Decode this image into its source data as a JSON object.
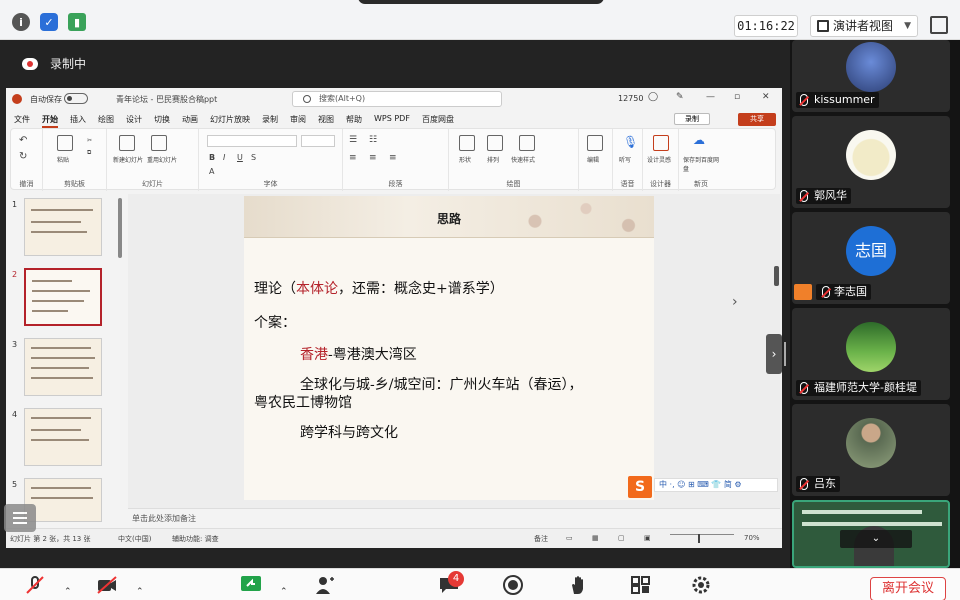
{
  "topbar": {
    "timer": "01:16:22",
    "view_mode": "演讲者视图"
  },
  "recording": {
    "label": "录制中"
  },
  "ppt": {
    "autosave": "自动保存",
    "filename": "青年论坛 - 巴民赛股合稿ppt",
    "search_placeholder": "搜索(Alt+Q)",
    "number": "12750",
    "menu": [
      "文件",
      "开始",
      "插入",
      "绘图",
      "设计",
      "切换",
      "动画",
      "幻灯片放映",
      "录制",
      "审阅",
      "视图",
      "帮助",
      "WPS PDF",
      "百度网盘"
    ],
    "record_button": "录制",
    "share_button": "共享",
    "ribbon_groups": [
      "撤消",
      "剪贴板",
      "幻灯片",
      "字体",
      "段落",
      "绘图",
      "",
      "语音",
      "设计器",
      "新页"
    ],
    "ribbon_items": {
      "paste": "粘贴",
      "new_slide": "新建幻灯片",
      "reuse_slide": "重用幻灯片",
      "shape": "形状",
      "arrange": "排列",
      "quick_style": "快速样式",
      "edit": "编辑",
      "dictate": "听写",
      "designer": "设计灵感",
      "save_to": "保存到百度网盘"
    },
    "slide_numbers": [
      "1",
      "2",
      "3",
      "4",
      "5"
    ],
    "slide": {
      "title": "思路",
      "line1_prefix": "理论（",
      "line1_red": "本体论",
      "line1_suffix": "，还需：概念史+谱系学）",
      "line2": "个案：",
      "line3_red": "香港",
      "line3_suffix": "-粤港澳大湾区",
      "line4": "全球化与城-乡/城空间：广州火车站（春运），",
      "line5": "粤农民工博物馆",
      "line6": "跨学科与跨文化"
    },
    "ime_bar": "中 ·, ☺ ⊞ ⌨ 👕 简 ⚙",
    "notes_placeholder": "单击此处添加备注",
    "status": {
      "slide_info": "幻灯片 第 2 张，共 13 张",
      "language": "中文(中国)",
      "accessibility": "辅助功能: 调查",
      "notes": "备注",
      "zoom": "70%"
    }
  },
  "participants": [
    {
      "name": "kissummer"
    },
    {
      "name": "郭风华"
    },
    {
      "name": "李志国",
      "avatar_text": "志国"
    },
    {
      "name": "福建师范大学-颜桂堤"
    },
    {
      "name": "吕东"
    },
    {
      "name": ""
    }
  ],
  "bottombar": {
    "chat_count": "4",
    "leave_label": "离开会议"
  },
  "colors": {
    "accent_red": "#b4222a",
    "ppt_orange": "#c43e1c",
    "avatar_blue": "#1e6fd6",
    "leave_red": "#d33333"
  }
}
